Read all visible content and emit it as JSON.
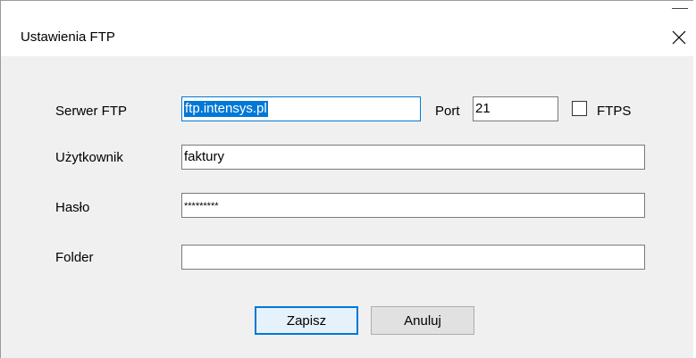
{
  "window": {
    "title": "Ustawienia FTP",
    "close_icon": "close-icon"
  },
  "form": {
    "server": {
      "label": "Serwer FTP",
      "value": "ftp.intensys.pl"
    },
    "port": {
      "label": "Port",
      "value": "21"
    },
    "ftps": {
      "label": "FTPS",
      "checked": false
    },
    "user": {
      "label": "Użytkownik",
      "value": "faktury"
    },
    "password": {
      "label": "Hasło",
      "value": "*********"
    },
    "folder": {
      "label": "Folder",
      "value": ""
    }
  },
  "buttons": {
    "save": "Zapisz",
    "cancel": "Anuluj"
  },
  "colors": {
    "accent": "#0078d7",
    "dialog_background": "#f0f0f0",
    "titlebar_background": "#ffffff"
  }
}
